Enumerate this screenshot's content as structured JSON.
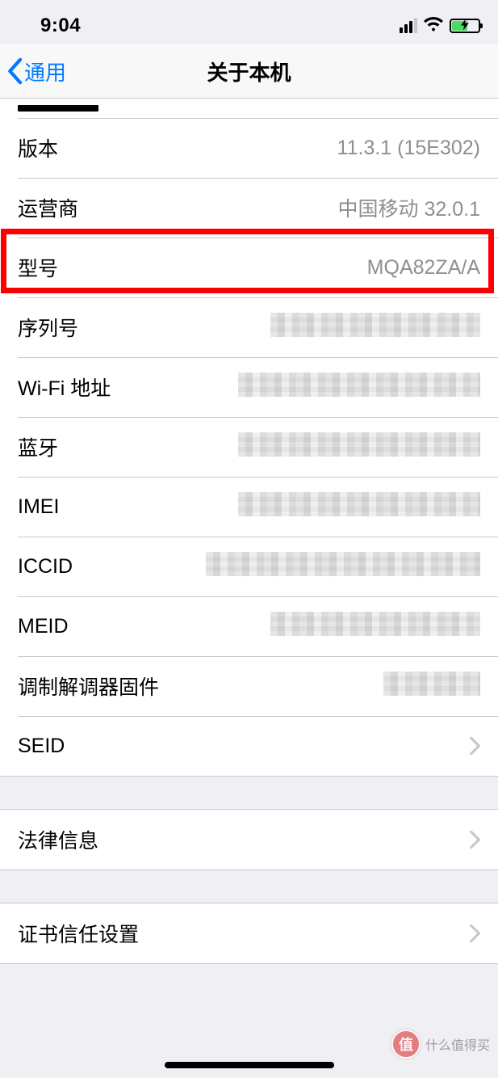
{
  "status": {
    "time": "9:04"
  },
  "nav": {
    "back_label": "通用",
    "title": "关于本机"
  },
  "rows": {
    "version": {
      "label": "版本",
      "value": "11.3.1 (15E302)"
    },
    "carrier": {
      "label": "运营商",
      "value": "中国移动 32.0.1"
    },
    "model": {
      "label": "型号",
      "value": "MQA82ZA/A"
    },
    "serial": {
      "label": "序列号"
    },
    "wifi": {
      "label": "Wi-Fi 地址"
    },
    "bluetooth": {
      "label": "蓝牙"
    },
    "imei": {
      "label": "IMEI"
    },
    "iccid": {
      "label": "ICCID"
    },
    "meid": {
      "label": "MEID"
    },
    "modem": {
      "label": "调制解调器固件"
    },
    "seid": {
      "label": "SEID"
    },
    "legal": {
      "label": "法律信息"
    },
    "certs": {
      "label": "证书信任设置"
    }
  },
  "watermark": {
    "logo": "值",
    "text": "什么值得买"
  }
}
